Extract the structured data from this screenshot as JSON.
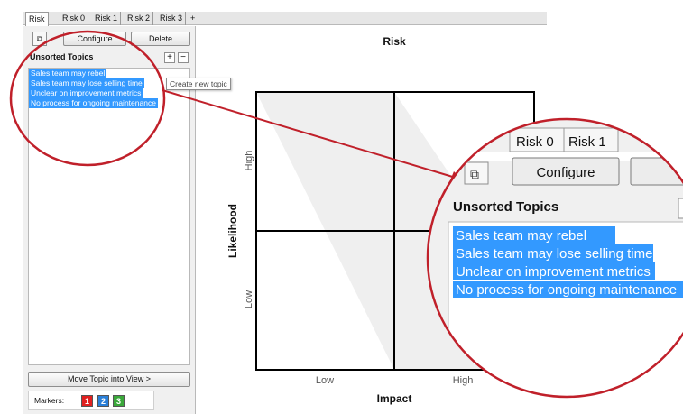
{
  "tabs": [
    "Risk",
    "Risk 0",
    "Risk 1",
    "Risk 2",
    "Risk 3",
    "+"
  ],
  "toolbar": {
    "configure_label": "Configure",
    "delete_label": "Delete",
    "copy_icon": "copy-icon"
  },
  "topics_panel": {
    "title": "Unsorted Topics",
    "add_label": "+",
    "remove_label": "−",
    "items": [
      "Sales team may rebel",
      "Sales team may lose selling time",
      "Unclear on improvement metrics",
      "No process for ongoing maintenance"
    ],
    "tooltip": "Create new topic"
  },
  "move_button_label": "Move Topic into View >",
  "markers": {
    "label": "Markers:",
    "items": [
      "1",
      "2",
      "3"
    ],
    "colors": [
      "#e02020",
      "#2a7fd8",
      "#3aa83a"
    ]
  },
  "chart": {
    "title": "Risk",
    "xlabel": "Impact",
    "ylabel": "Likelihood",
    "x_ticks": [
      "Low",
      "High"
    ],
    "y_ticks": [
      "High",
      "Low"
    ]
  },
  "zoom": {
    "tabs": [
      "Risk 0",
      "Risk 1"
    ],
    "configure_label": "Configure",
    "panel_title": "Unsorted Topics"
  },
  "colors": {
    "selection": "#3399ff",
    "callout": "#c0202a"
  }
}
